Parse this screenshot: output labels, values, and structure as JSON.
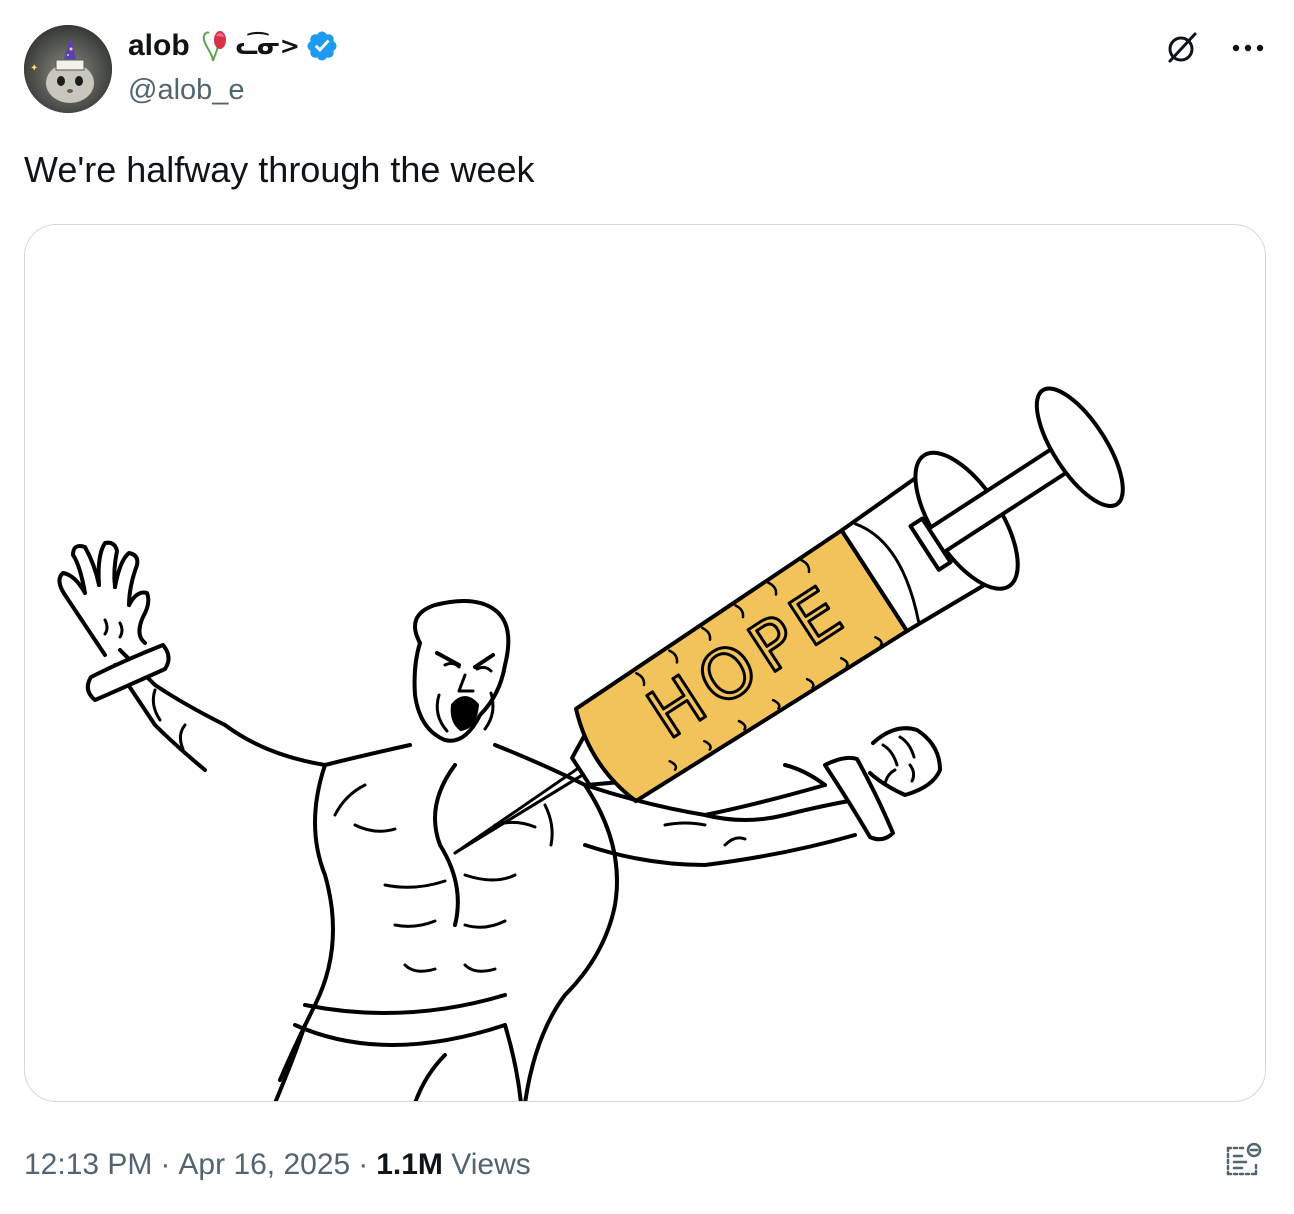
{
  "author": {
    "display_name": "alob",
    "decoration_text": "ᓚ͡ᓂ>",
    "handle": "@alob_e",
    "verified": true,
    "avatar_icon": "cat-wizard-avatar"
  },
  "tweet": {
    "text": "We're halfway through the week"
  },
  "media": {
    "syringe_label": "HOPE",
    "colors": {
      "syringe_fluid": "#f2c35a",
      "line": "#000000"
    }
  },
  "meta": {
    "time": "12:13 PM",
    "separator": "·",
    "date": "Apr 16, 2025",
    "views_count": "1.1M",
    "views_label": "Views"
  },
  "icons": {
    "grok": "grok-icon",
    "more": "more-icon",
    "verified": "verified-badge-icon",
    "flower": "flower-emoji-icon",
    "post_insights": "post-insights-icon"
  },
  "colors": {
    "text_primary": "#0f1419",
    "text_secondary": "#536471",
    "verified_blue": "#1d9bf0",
    "border": "#cfd9de"
  }
}
